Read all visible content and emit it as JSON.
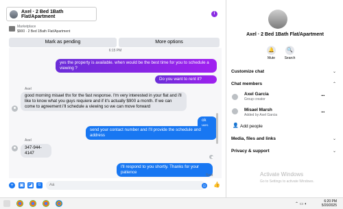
{
  "header": {
    "title": "Axel · 2 Bed 1Bath Flat/Apartment",
    "info_icon": "i"
  },
  "marketplace": {
    "label": "Marketplace",
    "listing": "$900 · 2 Bed 1Bath Flat/Apartment"
  },
  "actions": {
    "mark_pending": "Mark as pending",
    "more_options": "More options"
  },
  "thread": {
    "timestamp": "6:15 PM",
    "messages": [
      {
        "text": "yes the property is available. when would be the best time for you to schedule a viewing ?"
      },
      {
        "text": "Do you want to rent it?"
      },
      {
        "sender": "Axel",
        "text": "good morning misael thx for the fast response. I'm very interested in your flat and i'll like to know what you guys requiere and if it's actually $900 a month. If we can come to agreement i'll schedule a viewing so we can move forward"
      },
      {
        "text": "ok yes"
      },
      {
        "text": "send your contact number and I'll provide the schedule and address"
      },
      {
        "sender": "Axel",
        "text": "347-944-4147"
      },
      {
        "text": "I'll respond to you shortly. Thanks for your patience",
        "status": "Sent"
      }
    ]
  },
  "composer": {
    "placeholder": "Aa",
    "emoji_icon": "☺",
    "like_icon": "👍"
  },
  "sidebar": {
    "name": "Axel · 2 Bed 1Bath Flat/Apartment",
    "mute_label": "Mute",
    "search_label": "Search",
    "customize_chat": "Customize chat",
    "chat_members": "Chat members",
    "members": [
      {
        "name": "Axel Garcia",
        "role": "Group creator"
      },
      {
        "name": "Misael Marsh",
        "role": "Added by Axel Garcia"
      }
    ],
    "add_people": "Add people",
    "media_files_links": "Media, files and links",
    "privacy_support": "Privacy & support"
  },
  "watermark": {
    "line1": "Activate Windows",
    "line2": "Go to Settings to activate Windows."
  },
  "taskbar": {
    "time": "6:20 PM",
    "date": "5/20/2025"
  },
  "colors": {
    "accent": "#1877f2",
    "purple": "#8a2be2"
  }
}
